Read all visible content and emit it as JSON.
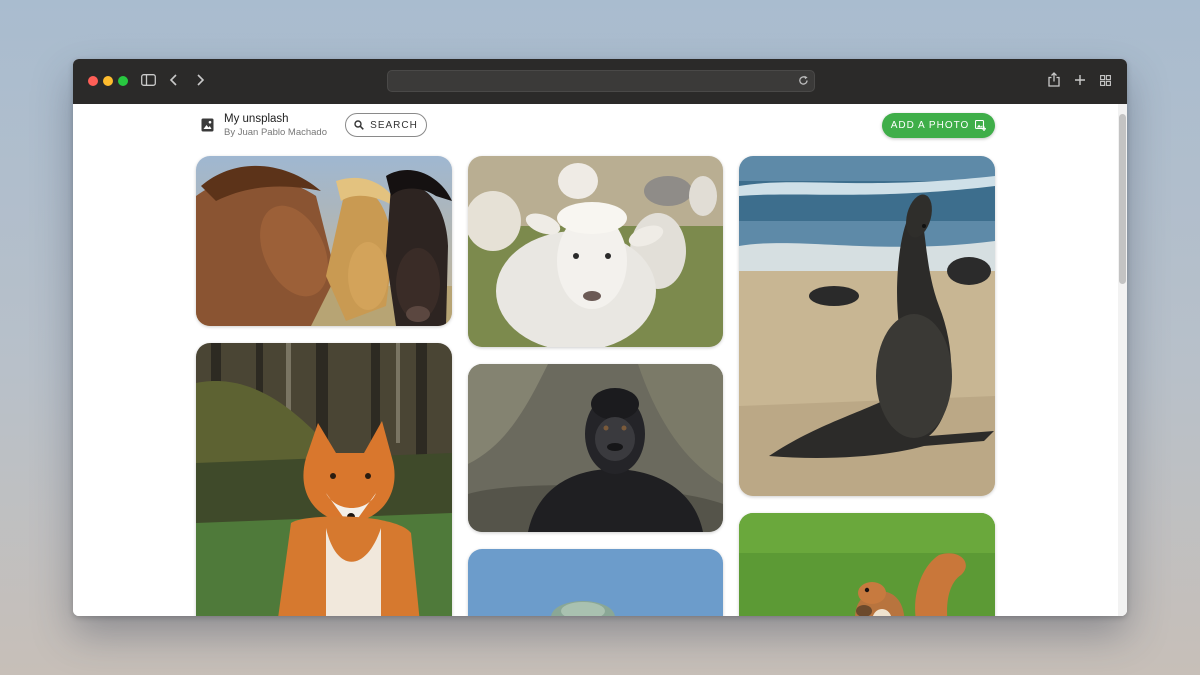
{
  "browser": {
    "icons": {
      "close": "close-dot",
      "minimize": "minimize-dot",
      "zoom": "zoom-dot",
      "sidebar": "sidebar-icon",
      "back": "chevron-left-icon",
      "forward": "chevron-right-icon",
      "reload": "reload-icon",
      "share": "share-icon",
      "new_tab": "plus-icon",
      "tabs": "grid-icon"
    },
    "colors": {
      "toolbar": "#2b2a29",
      "close": "#ff5f57",
      "minimize": "#febc2e",
      "zoom": "#28c840"
    }
  },
  "header": {
    "title": "My unsplash",
    "subtitle": "By Juan Pablo Machado",
    "search_label": "SEARCH",
    "add_label": "ADD A PHOTO",
    "accent": "#3fae49"
  },
  "gallery": {
    "photos": [
      {
        "subject": "horses"
      },
      {
        "subject": "fox"
      },
      {
        "subject": "sheep"
      },
      {
        "subject": "gorilla"
      },
      {
        "subject": "bird"
      },
      {
        "subject": "sea-lion"
      },
      {
        "subject": "squirrel"
      }
    ]
  }
}
